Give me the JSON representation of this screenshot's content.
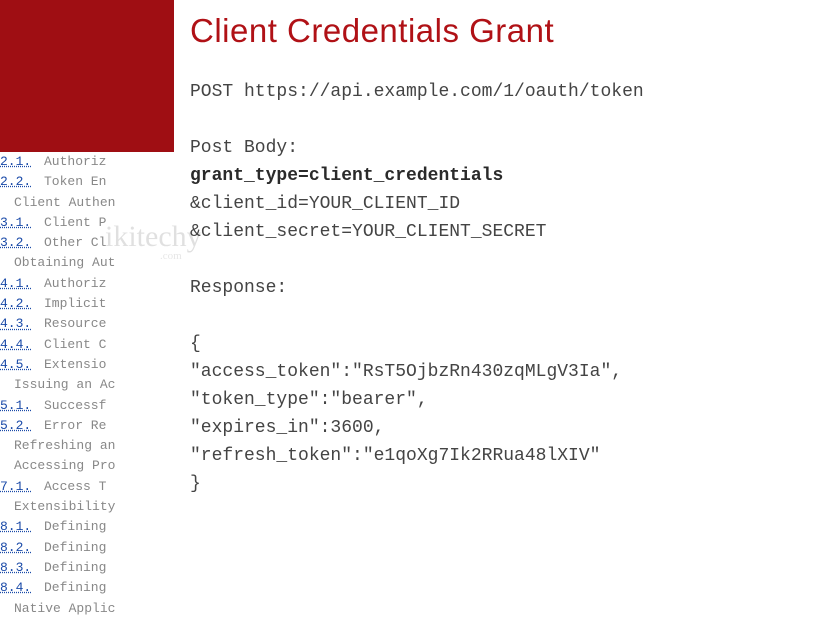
{
  "title": "Client Credentials Grant",
  "request_line": "POST https://api.example.com/1/oauth/token",
  "post_body_label": "Post Body:",
  "body_line1": "grant_type=client_credentials",
  "body_line2": "&client_id=YOUR_CLIENT_ID",
  "body_line3": "&client_secret=YOUR_CLIENT_SECRET",
  "response_label": "Response:",
  "response_l1": "{",
  "response_l2": "  \"access_token\":\"RsT5OjbzRn430zqMLgV3Ia\",",
  "response_l3": "  \"token_type\":\"bearer\",",
  "response_l4": "  \"expires_in\":3600,",
  "response_l5": "  \"refresh_token\":\"e1qoXg7Ik2RRua48lXIV\"",
  "response_l6": "}",
  "toc": [
    {
      "num": "2.1.",
      "text": "Authoriz",
      "type": "link"
    },
    {
      "num": "2.2.",
      "text": "Token En",
      "type": "link"
    },
    {
      "text": "Client Authen",
      "type": "title"
    },
    {
      "num": "3.1.",
      "text": "Client P",
      "type": "link"
    },
    {
      "num": "3.2.",
      "text": "Other Cl",
      "type": "link"
    },
    {
      "text": "Obtaining Aut",
      "type": "title"
    },
    {
      "num": "4.1.",
      "text": "Authoriz",
      "type": "link"
    },
    {
      "num": "4.2.",
      "text": "Implicit",
      "type": "link"
    },
    {
      "num": "4.3.",
      "text": "Resource",
      "type": "link"
    },
    {
      "num": "4.4.",
      "text": "Client C",
      "type": "link"
    },
    {
      "num": "4.5.",
      "text": "Extensio",
      "type": "link"
    },
    {
      "text": "Issuing an Ac",
      "type": "title"
    },
    {
      "num": "5.1.",
      "text": "Successf",
      "type": "link"
    },
    {
      "num": "5.2.",
      "text": "Error Re",
      "type": "link"
    },
    {
      "text": "Refreshing an",
      "type": "title"
    },
    {
      "text": "Accessing Pro",
      "type": "title"
    },
    {
      "num": "7.1.",
      "text": "Access T",
      "type": "link"
    },
    {
      "text": "Extensibility",
      "type": "title"
    },
    {
      "num": "8.1.",
      "text": "Defining",
      "type": "link"
    },
    {
      "num": "8.2.",
      "text": "Defining",
      "type": "link"
    },
    {
      "num": "8.3.",
      "text": "Defining",
      "type": "link"
    },
    {
      "num": "8.4.",
      "text": "Defining",
      "type": "link"
    },
    {
      "text": "Native Applic",
      "type": "title"
    }
  ],
  "watermark": "ikitechy",
  "watermark_sub": ".com"
}
